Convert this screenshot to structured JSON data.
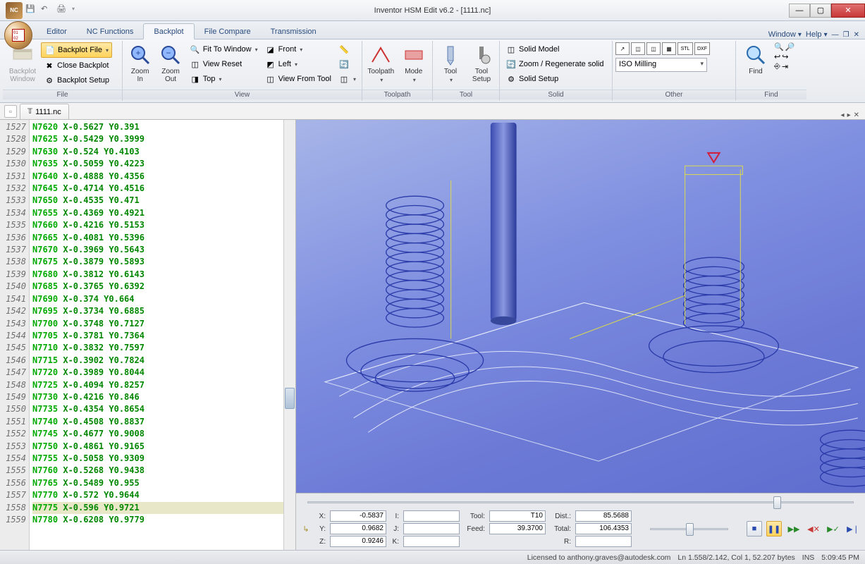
{
  "app": {
    "title": "Inventor HSM Edit v6.2 - [1111.nc]"
  },
  "menuRight": {
    "window": "Window",
    "help": "Help"
  },
  "tabs": {
    "editor": "Editor",
    "ncfunctions": "NC Functions",
    "backplot": "Backplot",
    "filecompare": "File Compare",
    "transmission": "Transmission"
  },
  "ribbon": {
    "file": {
      "label": "File",
      "backplotWindow": "Backplot\nWindow",
      "backplotFile": "Backplot File",
      "closeBackplot": "Close Backplot",
      "backplotSetup": "Backplot Setup"
    },
    "view": {
      "label": "View",
      "zoomIn": "Zoom\nIn",
      "zoomOut": "Zoom\nOut",
      "fitToWindow": "Fit To Window",
      "viewReset": "View Reset",
      "top": "Top",
      "front": "Front",
      "left": "Left",
      "viewFromTool": "View From Tool"
    },
    "toolpath": {
      "label": "Toolpath",
      "toolpath": "Toolpath",
      "mode": "Mode"
    },
    "tool": {
      "label": "Tool",
      "tool": "Tool",
      "toolSetup": "Tool\nSetup"
    },
    "solid": {
      "label": "Solid",
      "solidModel": "Solid Model",
      "zoomRegen": "Zoom / Regenerate solid",
      "solidSetup": "Solid Setup"
    },
    "other": {
      "label": "Other",
      "combo": "ISO Milling"
    },
    "find": {
      "label": "Find",
      "find": "Find"
    }
  },
  "docTab": {
    "name": "1111.nc"
  },
  "code": {
    "startLine": 1527,
    "lines": [
      "N7620 X-0.5627 Y0.391",
      "N7625 X-0.5429 Y0.3999",
      "N7630 X-0.524 Y0.4103",
      "N7635 X-0.5059 Y0.4223",
      "N7640 X-0.4888 Y0.4356",
      "N7645 X-0.4714 Y0.4516",
      "N7650 X-0.4535 Y0.471",
      "N7655 X-0.4369 Y0.4921",
      "N7660 X-0.4216 Y0.5153",
      "N7665 X-0.4081 Y0.5396",
      "N7670 X-0.3969 Y0.5643",
      "N7675 X-0.3879 Y0.5893",
      "N7680 X-0.3812 Y0.6143",
      "N7685 X-0.3765 Y0.6392",
      "N7690 X-0.374 Y0.664",
      "N7695 X-0.3734 Y0.6885",
      "N7700 X-0.3748 Y0.7127",
      "N7705 X-0.3781 Y0.7364",
      "N7710 X-0.3832 Y0.7597",
      "N7715 X-0.3902 Y0.7824",
      "N7720 X-0.3989 Y0.8044",
      "N7725 X-0.4094 Y0.8257",
      "N7730 X-0.4216 Y0.846",
      "N7735 X-0.4354 Y0.8654",
      "N7740 X-0.4508 Y0.8837",
      "N7745 X-0.4677 Y0.9008",
      "N7750 X-0.4861 Y0.9165",
      "N7755 X-0.5058 Y0.9309",
      "N7760 X-0.5268 Y0.9438",
      "N7765 X-0.5489 Y0.955",
      "N7770 X-0.572 Y0.9644",
      "N7775 X-0.596 Y0.9721",
      "N7780 X-0.6208 Y0.9779"
    ],
    "hlIndex": 31
  },
  "readout": {
    "X": "-0.5837",
    "Y": "0.9682",
    "Z": "0.9246",
    "I": "",
    "J": "",
    "K": "",
    "Tool": "T10",
    "Feed": "39.3700",
    "R": "",
    "Dist": "85.5688",
    "Total": "106.4353",
    "labels": {
      "X": "X:",
      "Y": "Y:",
      "Z": "Z:",
      "I": "I:",
      "J": "J:",
      "K": "K:",
      "Tool": "Tool:",
      "Feed": "Feed:",
      "R": "R:",
      "Dist": "Dist.:",
      "Total": "Total:"
    }
  },
  "status": {
    "license": "Licensed to anthony.graves@autodesk.com",
    "pos": "Ln 1.558/2.142, Col 1, 52.207 bytes",
    "ins": "INS",
    "time": "5:09:45 PM"
  }
}
